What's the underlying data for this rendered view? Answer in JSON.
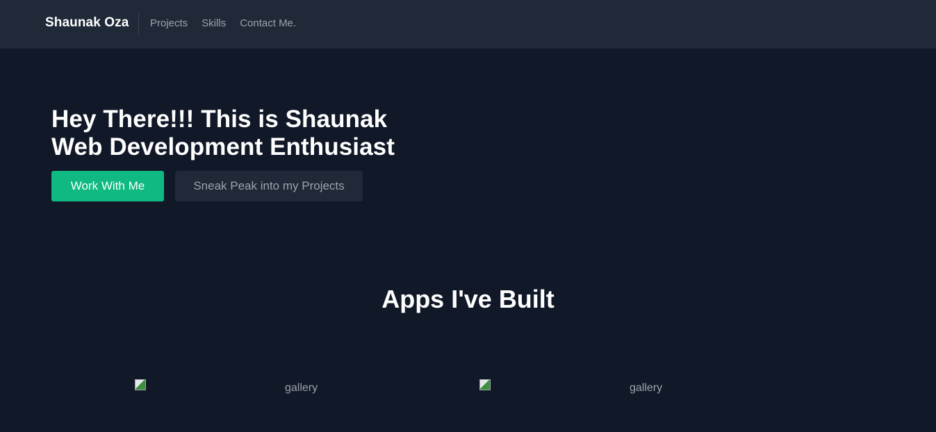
{
  "nav": {
    "brand": "Shaunak Oza",
    "links": [
      "Projects",
      "Skills",
      "Contact Me."
    ]
  },
  "hero": {
    "title_line1": "Hey There!!! This is Shaunak",
    "title_line2": "Web Development Enthusiast",
    "primary_button": "Work With Me",
    "secondary_button": "Sneak Peak into my Projects"
  },
  "apps": {
    "title": "Apps I've Built",
    "gallery": [
      {
        "alt": "gallery"
      },
      {
        "alt": "gallery"
      }
    ]
  },
  "colors": {
    "background": "#111827",
    "navbar": "#1f2937",
    "accent": "#10b981",
    "text_muted": "#9ca3af"
  }
}
